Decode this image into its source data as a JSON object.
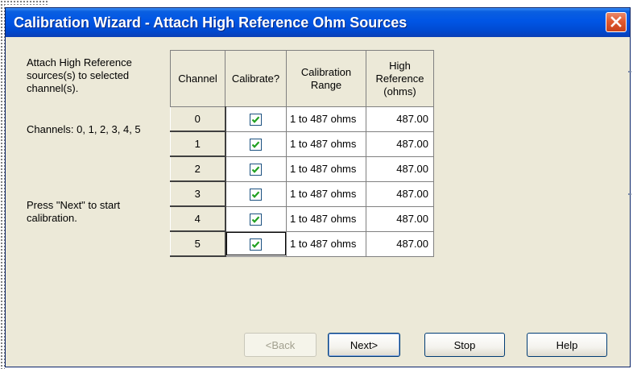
{
  "window": {
    "title": "Calibration Wizard - Attach High Reference Ohm Sources"
  },
  "instructions": {
    "attach_text": "Attach High Reference sources(s) to selected channel(s).",
    "channels_text": "Channels:  0, 1, 2, 3, 4, 5",
    "press_next_text": "Press \"Next\" to start calibration."
  },
  "table": {
    "headers": {
      "channel": "Channel",
      "calibrate": "Calibrate?",
      "range": "Calibration Range",
      "reference": "High Reference (ohms)"
    },
    "rows": [
      {
        "channel": "0",
        "calibrate": true,
        "range": "1 to 487 ohms",
        "reference": "487.00"
      },
      {
        "channel": "1",
        "calibrate": true,
        "range": "1 to 487 ohms",
        "reference": "487.00"
      },
      {
        "channel": "2",
        "calibrate": true,
        "range": "1 to 487 ohms",
        "reference": "487.00"
      },
      {
        "channel": "3",
        "calibrate": true,
        "range": "1 to 487 ohms",
        "reference": "487.00"
      },
      {
        "channel": "4",
        "calibrate": true,
        "range": "1 to 487 ohms",
        "reference": "487.00"
      },
      {
        "channel": "5",
        "calibrate": true,
        "range": "1 to 487 ohms",
        "reference": "487.00"
      }
    ]
  },
  "buttons": {
    "back": "<Back",
    "next": "Next>",
    "stop": "Stop",
    "help": "Help"
  },
  "icons": {
    "close": "close-icon",
    "checkbox": "checkmark-icon"
  },
  "colors": {
    "titlebar": "#0055e5",
    "close": "#e05a30",
    "checkmark": "#21a121",
    "dialog_bg": "#ece9d8"
  }
}
